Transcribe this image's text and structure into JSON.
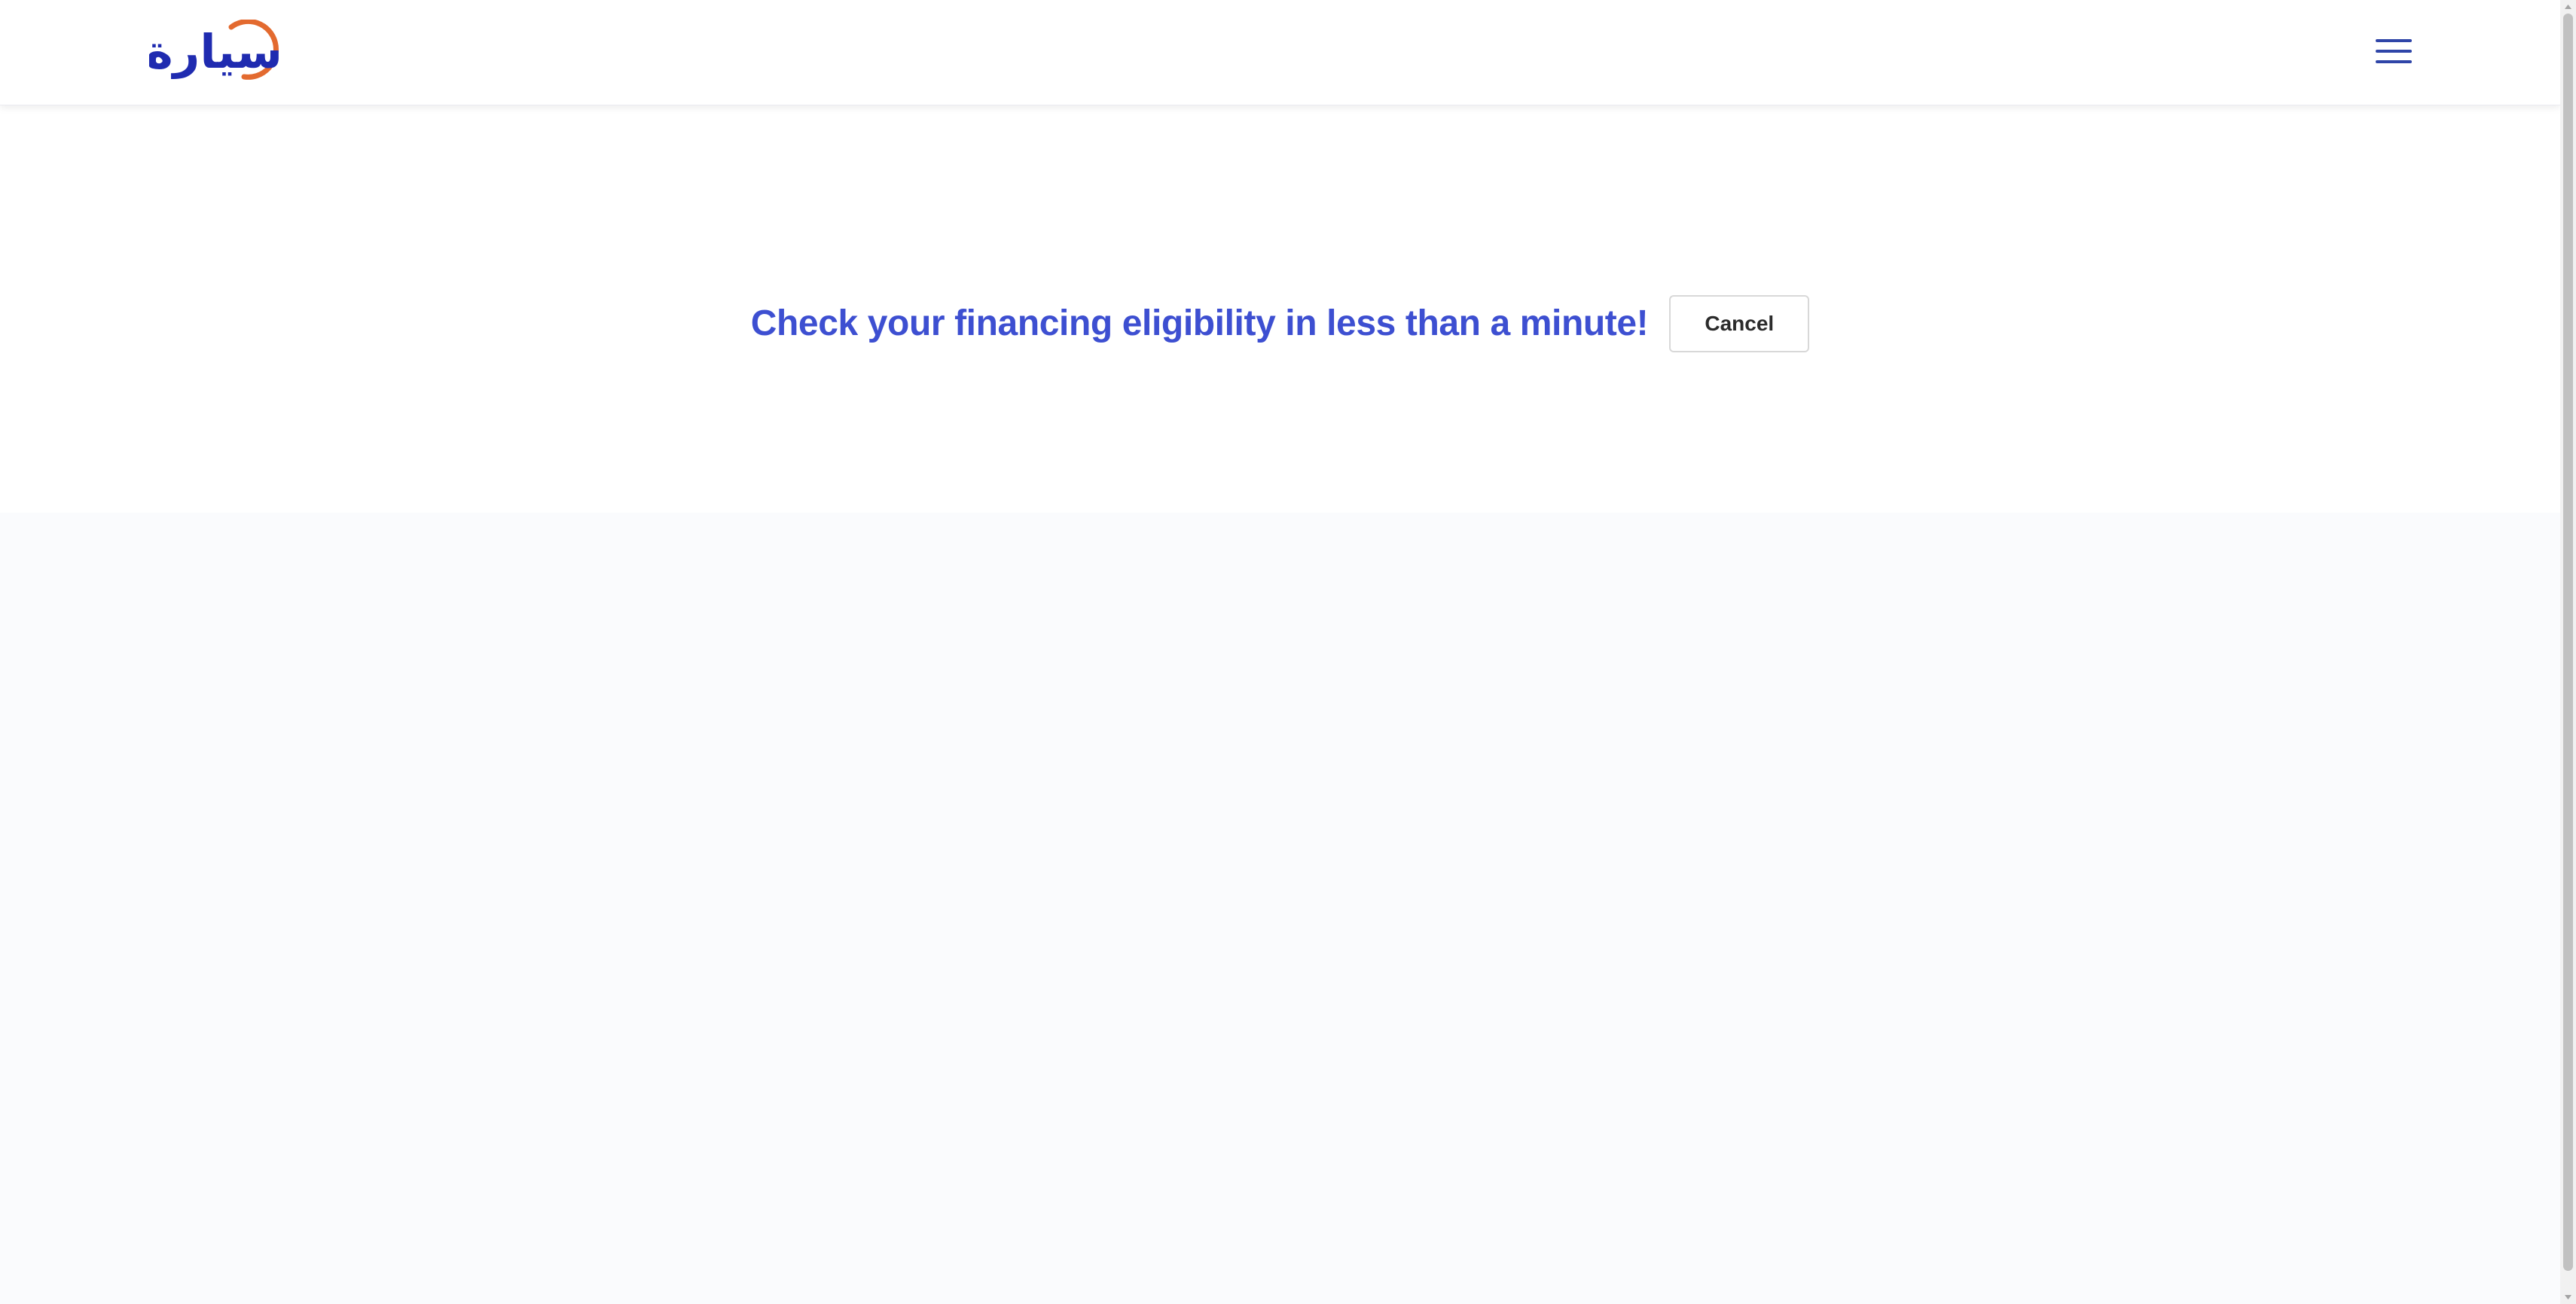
{
  "header": {
    "logo_text": "سيارة",
    "menu_icon": "hamburger-menu-icon"
  },
  "main": {
    "title": "Check your financing eligibility in less than a minute!",
    "cancel_label": "Cancel"
  },
  "colors": {
    "brand_blue": "#3d4fd1",
    "logo_navy": "#1f2bb0",
    "logo_orange": "#e36a2f",
    "page_background": "#fafbfd"
  }
}
